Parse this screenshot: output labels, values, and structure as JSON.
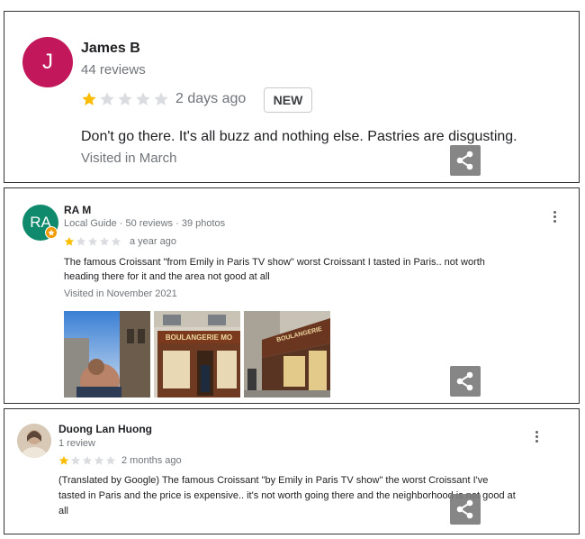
{
  "reviews": [
    {
      "avatar_letter": "J",
      "avatar_color": "#c2185b",
      "name": "James B",
      "meta": "44 reviews",
      "rating": 1,
      "time": "2 days ago",
      "badge": "NEW",
      "text": "Don't go there. It's all buzz and nothing else. Pastries are disgusting.",
      "visited": "Visited in March"
    },
    {
      "avatar_letter": "RA",
      "avatar_color": "#0f8a6c",
      "name": "RA M",
      "meta": "Local Guide · 50 reviews · 39 photos",
      "rating": 1,
      "time": "a year ago",
      "text_line1": "The famous Croissant \"from Emily in Paris TV show\" worst Croissant I tasted in Paris.. not worth",
      "text_line2": "heading there for it and the area not good at all",
      "visited": "Visited in November 2021",
      "photos": [
        {
          "sign": ""
        },
        {
          "sign": "BOULANGERIE MO"
        },
        {
          "sign": "BOULANGERIE"
        }
      ]
    },
    {
      "name": "Duong Lan Huong",
      "meta": "1 review",
      "rating": 1,
      "time": "2 months ago",
      "text_line1": "(Translated by Google) The famous Croissant \"by Emily in Paris TV show\" the worst Croissant I've",
      "text_line2": "tasted in Paris and the price is expensive.. it's not worth going there and the neighborhood is not good at",
      "text_line3": "all"
    }
  ],
  "colors": {
    "star_filled": "#fbbc04",
    "star_empty": "#dadce0",
    "share_bg": "#7a7a7a"
  },
  "icons": {
    "share": "share-icon",
    "more": "more-vert-icon",
    "local_guide_badge": "local-guide-badge-icon",
    "star": "star-icon"
  }
}
